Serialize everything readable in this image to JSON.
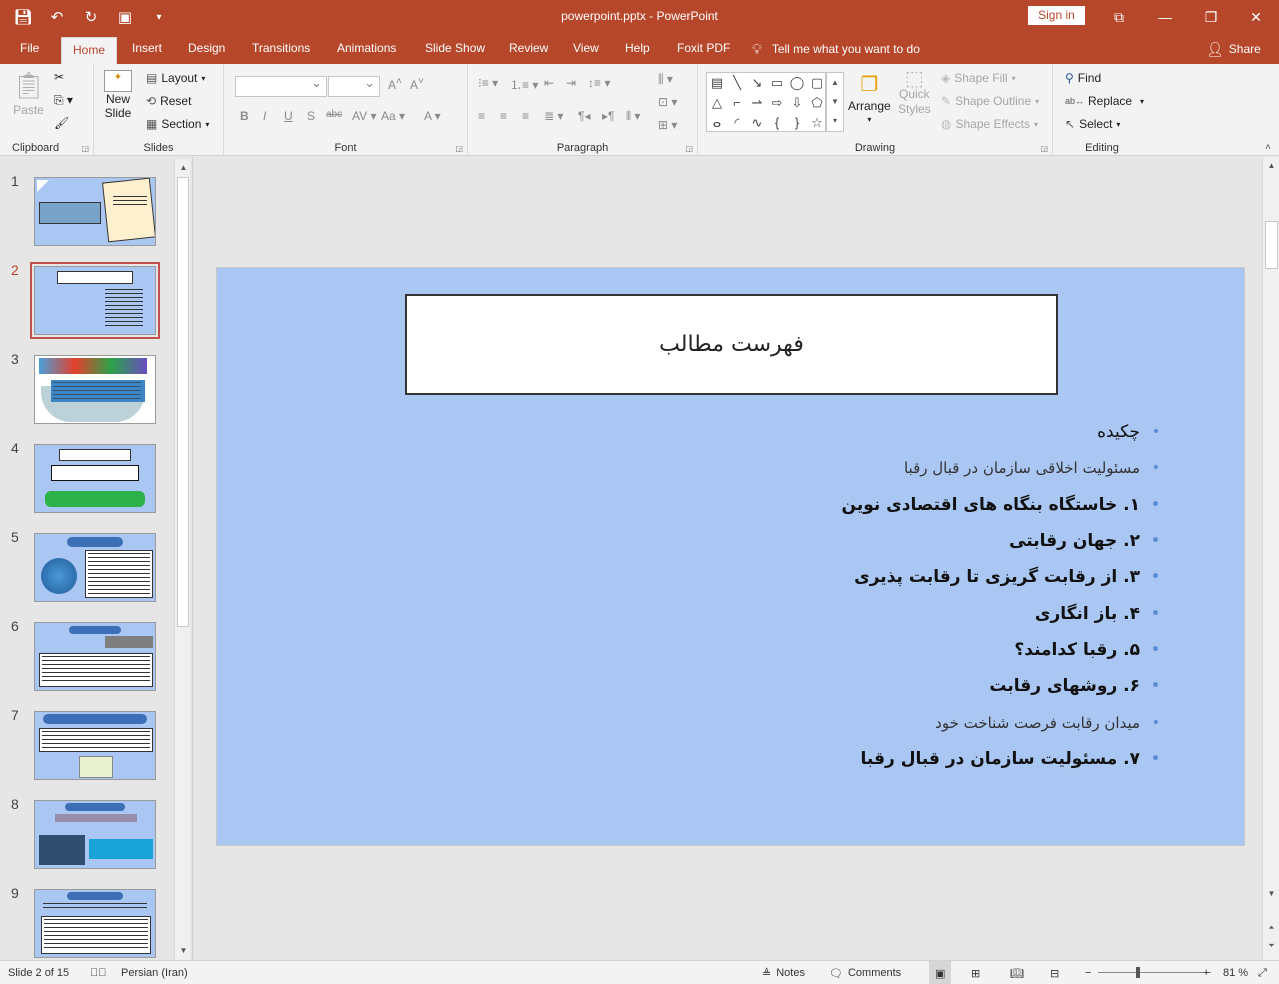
{
  "titlebar": {
    "title": "powerpoint.pptx  -  PowerPoint",
    "sign_in": "Sign in"
  },
  "tabs": [
    "File",
    "Home",
    "Insert",
    "Design",
    "Transitions",
    "Animations",
    "Slide Show",
    "Review",
    "View",
    "Help",
    "Foxit PDF"
  ],
  "tell_me": "Tell me what you want to do",
  "share": "Share",
  "ribbon": {
    "clipboard": {
      "paste": "Paste",
      "label": "Clipboard"
    },
    "slides": {
      "new_slide_1": "New",
      "new_slide_2": "Slide",
      "layout": "Layout",
      "reset": "Reset",
      "section": "Section",
      "label": "Slides"
    },
    "font": {
      "label": "Font"
    },
    "paragraph": {
      "label": "Paragraph"
    },
    "drawing": {
      "arrange": "Arrange",
      "quick_styles_1": "Quick",
      "quick_styles_2": "Styles",
      "shape_fill": "Shape Fill",
      "shape_outline": "Shape Outline",
      "shape_effects": "Shape Effects",
      "label": "Drawing"
    },
    "editing": {
      "find": "Find",
      "replace": "Replace",
      "select": "Select",
      "label": "Editing"
    }
  },
  "thumbnails": [
    {
      "num": "1"
    },
    {
      "num": "2"
    },
    {
      "num": "3"
    },
    {
      "num": "4"
    },
    {
      "num": "5"
    },
    {
      "num": "6"
    },
    {
      "num": "7"
    },
    {
      "num": "8"
    },
    {
      "num": "9"
    }
  ],
  "slide": {
    "title": "فهرست  مطالب",
    "bullets": [
      {
        "text": "چکیده",
        "style": "plain"
      },
      {
        "text": "مسئولیت اخلاقی سازمان در قبال رقبا",
        "style": "sub"
      },
      {
        "text": "۱. خاستگاه بنگاه های اقتصادی نوین",
        "style": "bold"
      },
      {
        "text": "۲. جهان رقابتی",
        "style": "bold"
      },
      {
        "text": "۳. از رقابت گریزی تا رقابت پذیری",
        "style": "bold"
      },
      {
        "text": "۴.  باز انگاری",
        "style": "bold"
      },
      {
        "text": "۵. رقبا کدامند؟",
        "style": "bold"
      },
      {
        "text": "۶. روشهای رقابت",
        "style": "bold"
      },
      {
        "text": "میدان رقابت فرصت شناخت خود",
        "style": "sub"
      },
      {
        "text": "۷. مسئولیت سازمان در قبال رقبا",
        "style": "bold"
      }
    ]
  },
  "status": {
    "slide_of": "Slide 2 of 15",
    "language": "Persian (Iran)",
    "notes": "Notes",
    "comments": "Comments",
    "zoom": "81 %",
    "zoom_value": 81
  },
  "colors": {
    "accent": "#b7472a",
    "slide_bg": "#a9c7f2",
    "bullet": "#5b8dd6"
  }
}
